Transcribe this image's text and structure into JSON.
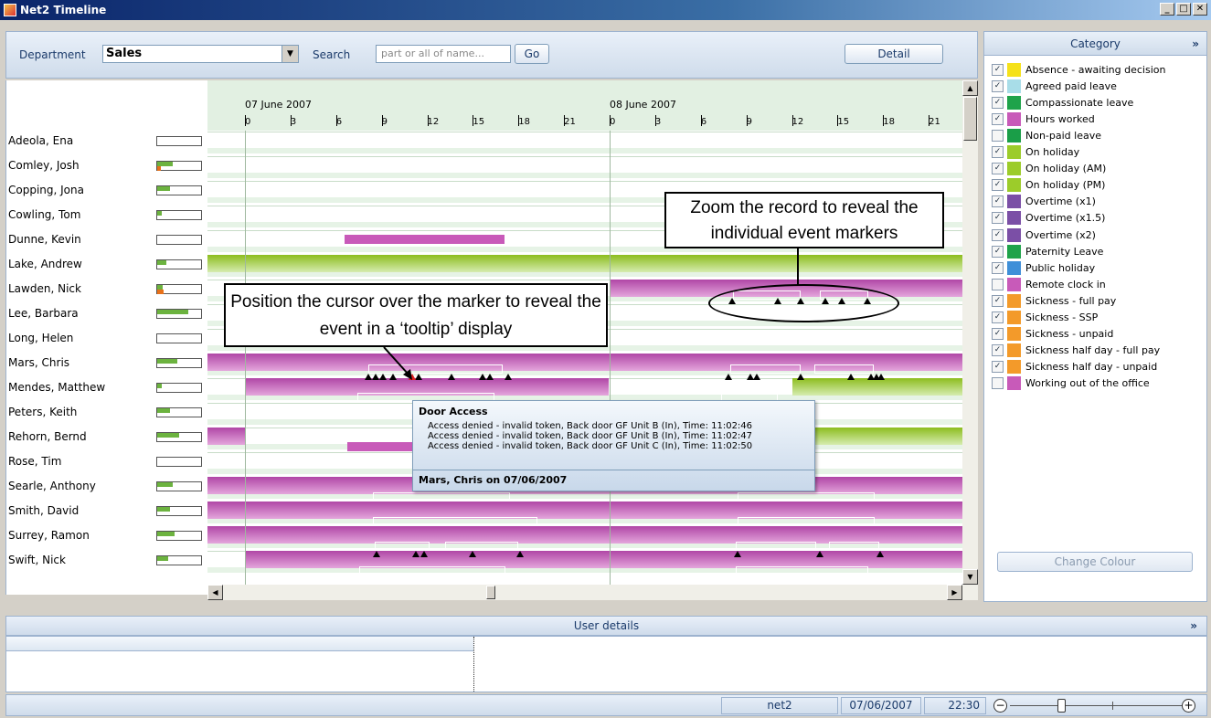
{
  "window": {
    "title": "Net2 Timeline"
  },
  "toolbar": {
    "department_label": "Department",
    "department_value": "Sales",
    "search_label": "Search",
    "search_placeholder": "part or all of name...",
    "go_label": "Go",
    "detail_label": "Detail"
  },
  "timeline": {
    "days": [
      "07 June 2007",
      "08 June 2007"
    ],
    "hours": [
      "0",
      "3",
      "6",
      "9",
      "12",
      "15",
      "18",
      "21"
    ]
  },
  "people": [
    {
      "name": "Adeola, Ena",
      "green": 0,
      "orange": 0
    },
    {
      "name": "Comley, Josh",
      "green": 0.35,
      "orange": 0.08
    },
    {
      "name": "Copping, Jona",
      "green": 0.3,
      "orange": 0
    },
    {
      "name": "Cowling, Tom",
      "green": 0.1,
      "orange": 0
    },
    {
      "name": "Dunne, Kevin",
      "green": 0,
      "orange": 0
    },
    {
      "name": "Lake, Andrew",
      "green": 0.2,
      "orange": 0
    },
    {
      "name": "Lawden, Nick",
      "green": 0.12,
      "orange": 0.15
    },
    {
      "name": "Lee, Barbara",
      "green": 0.7,
      "orange": 0
    },
    {
      "name": "Long, Helen",
      "green": 0,
      "orange": 0
    },
    {
      "name": "Mars, Chris",
      "green": 0.45,
      "orange": 0
    },
    {
      "name": "Mendes, Matthew",
      "green": 0.1,
      "orange": 0
    },
    {
      "name": "Peters, Keith",
      "green": 0.3,
      "orange": 0
    },
    {
      "name": "Rehorn, Bernd",
      "green": 0.5,
      "orange": 0
    },
    {
      "name": "Rose, Tim",
      "green": 0,
      "orange": 0
    },
    {
      "name": "Searle, Anthony",
      "green": 0.35,
      "orange": 0
    },
    {
      "name": "Smith, David",
      "green": 0.3,
      "orange": 0
    },
    {
      "name": "Surrey, Ramon",
      "green": 0.4,
      "orange": 0
    },
    {
      "name": "Swift, Nick",
      "green": 0.25,
      "orange": 0
    }
  ],
  "categories": {
    "header": "Category",
    "items": [
      {
        "label": "Absence - awaiting decision",
        "color": "#f5e11a",
        "checked": true
      },
      {
        "label": "Agreed paid leave",
        "color": "#a8dde8",
        "checked": true
      },
      {
        "label": "Compassionate leave",
        "color": "#1fa34a",
        "checked": true
      },
      {
        "label": "Hours worked",
        "color": "#c85ab9",
        "checked": true
      },
      {
        "label": "Non-paid leave",
        "color": "#1a9e48",
        "checked": false
      },
      {
        "label": "On holiday",
        "color": "#9ccc2a",
        "checked": true
      },
      {
        "label": "On holiday (AM)",
        "color": "#9ccc2a",
        "checked": true
      },
      {
        "label": "On holiday (PM)",
        "color": "#9ccc2a",
        "checked": true
      },
      {
        "label": "Overtime (x1)",
        "color": "#7b4fa6",
        "checked": true
      },
      {
        "label": "Overtime (x1.5)",
        "color": "#7b4fa6",
        "checked": true
      },
      {
        "label": "Overtime (x2)",
        "color": "#7b4fa6",
        "checked": true
      },
      {
        "label": "Paternity Leave",
        "color": "#1fa34a",
        "checked": true
      },
      {
        "label": "Public holiday",
        "color": "#3f8fd8",
        "checked": true
      },
      {
        "label": "Remote clock in",
        "color": "#c85ab9",
        "checked": false
      },
      {
        "label": "Sickness - full pay",
        "color": "#f39a2a",
        "checked": true
      },
      {
        "label": "Sickness - SSP",
        "color": "#f39a2a",
        "checked": true
      },
      {
        "label": "Sickness - unpaid",
        "color": "#f39a2a",
        "checked": true
      },
      {
        "label": "Sickness half day - full pay",
        "color": "#f39a2a",
        "checked": true
      },
      {
        "label": "Sickness half day - unpaid",
        "color": "#f39a2a",
        "checked": true
      },
      {
        "label": "Working out of the office",
        "color": "#c85ab9",
        "checked": false
      }
    ],
    "change_colour_label": "Change Colour"
  },
  "tooltip": {
    "title": "Door Access",
    "lines": [
      "Access denied - invalid token, Back door GF Unit B (In), Time: 11:02:46",
      "Access denied - invalid token, Back door GF Unit B (In), Time: 11:02:47",
      "Access denied - invalid token, Back door GF Unit C (In), Time: 11:02:50"
    ],
    "footer": "Mars, Chris on 07/06/2007"
  },
  "callouts": {
    "zoom": "Zoom the record to reveal the individual event markers",
    "cursor": "Position the cursor over the marker to reveal the event in a ‘tooltip’ display"
  },
  "user_details": {
    "label": "User details"
  },
  "status": {
    "user": "net2",
    "date": "07/06/2007",
    "time": "22:30"
  }
}
